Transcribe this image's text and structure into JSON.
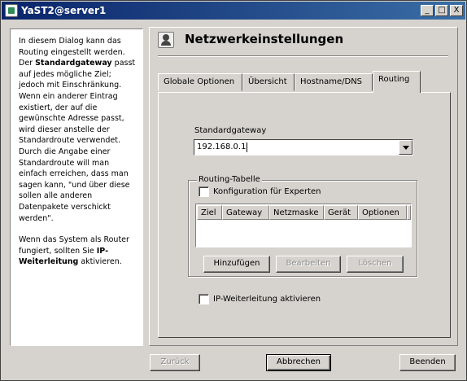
{
  "window": {
    "title": "YaST2@server1",
    "buttons": {
      "minimize": "_",
      "maximize": "□",
      "close": "X"
    }
  },
  "help": {
    "paragraph1": {
      "before": "In diesem Dialog kann das Routing eingestellt werden. Der ",
      "bold": "Standardgateway",
      "after": " passt auf jedes mögliche Ziel; jedoch mit Einschränkung. Wenn ein anderer Eintrag existiert, der auf die gewünschte Adresse passt, wird dieser anstelle der Standardroute verwendet. Durch die Angabe einer Standardroute will man einfach erreichen, dass man sagen kann, \"und über diese sollen alle anderen Datenpakete verschickt werden\"."
    },
    "paragraph2": {
      "before": "Wenn das System als Router fungiert, sollten Sie ",
      "bold": "IP-Weiterleitung",
      "after": " aktivieren."
    }
  },
  "header": {
    "title": "Netzwerkeinstellungen",
    "icon": "network-settings-icon"
  },
  "tabs": [
    {
      "label": "Globale Optionen",
      "active": false
    },
    {
      "label": "Übersicht",
      "active": false
    },
    {
      "label": "Hostname/DNS",
      "active": false
    },
    {
      "label": "Routing",
      "active": true
    }
  ],
  "routing": {
    "gateway_label": "Standardgateway",
    "gateway_value": "192.168.0.1",
    "table_group_label": "Routing-Tabelle",
    "expert_checkbox_label": "Konfiguration für Experten",
    "expert_checked": false,
    "columns": [
      "Ziel",
      "Gateway",
      "Netzmaske",
      "Gerät",
      "Optionen"
    ],
    "rows": [],
    "add_button": "Hinzufügen",
    "edit_button": "Bearbeiten",
    "delete_button": "Löschen",
    "ip_forward_label": "IP-Weiterleitung aktivieren",
    "ip_forward_checked": false
  },
  "footer": {
    "back": "Zurück",
    "cancel": "Abbrechen",
    "finish": "Beenden"
  }
}
